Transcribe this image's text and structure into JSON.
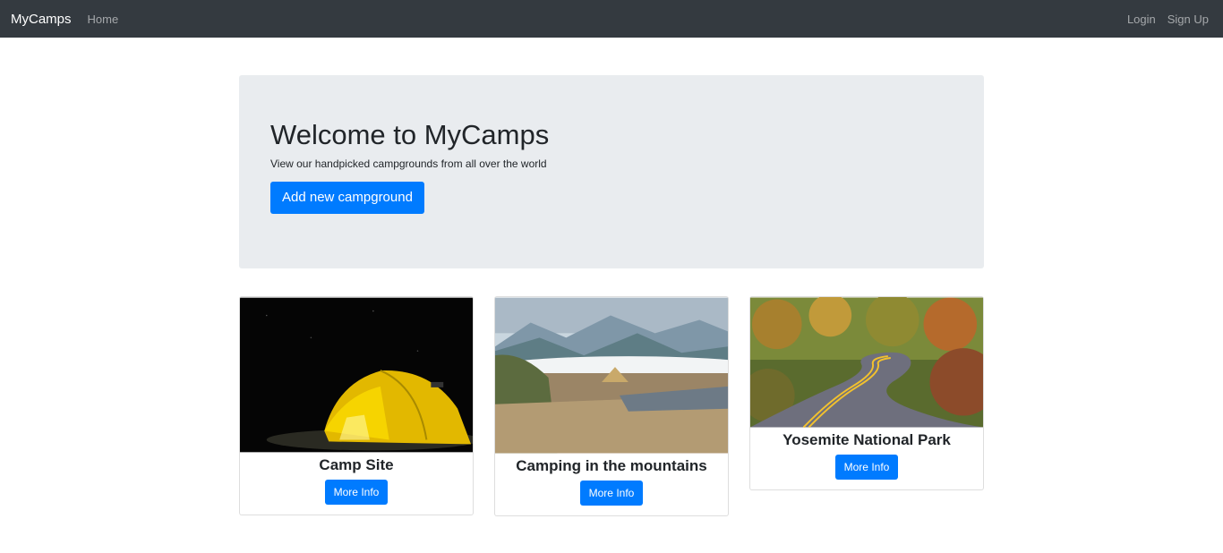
{
  "navbar": {
    "brand": "MyCamps",
    "home": "Home",
    "login": "Login",
    "signup": "Sign Up"
  },
  "jumbotron": {
    "title": "Welcome to MyCamps",
    "subtitle": "View our handpicked campgrounds from all over the world",
    "button": "Add new campground"
  },
  "campgrounds": [
    {
      "name": "Camp Site",
      "button": "More Info",
      "image": "night-tent-photo"
    },
    {
      "name": "Camping in the mountains",
      "button": "More Info",
      "image": "mountain-tent-photo"
    },
    {
      "name": "Yosemite National Park",
      "button": "More Info",
      "image": "forest-road-photo"
    }
  ],
  "colors": {
    "navbar_bg": "#343a40",
    "primary": "#007bff",
    "jumbotron_bg": "#e9ecef"
  }
}
